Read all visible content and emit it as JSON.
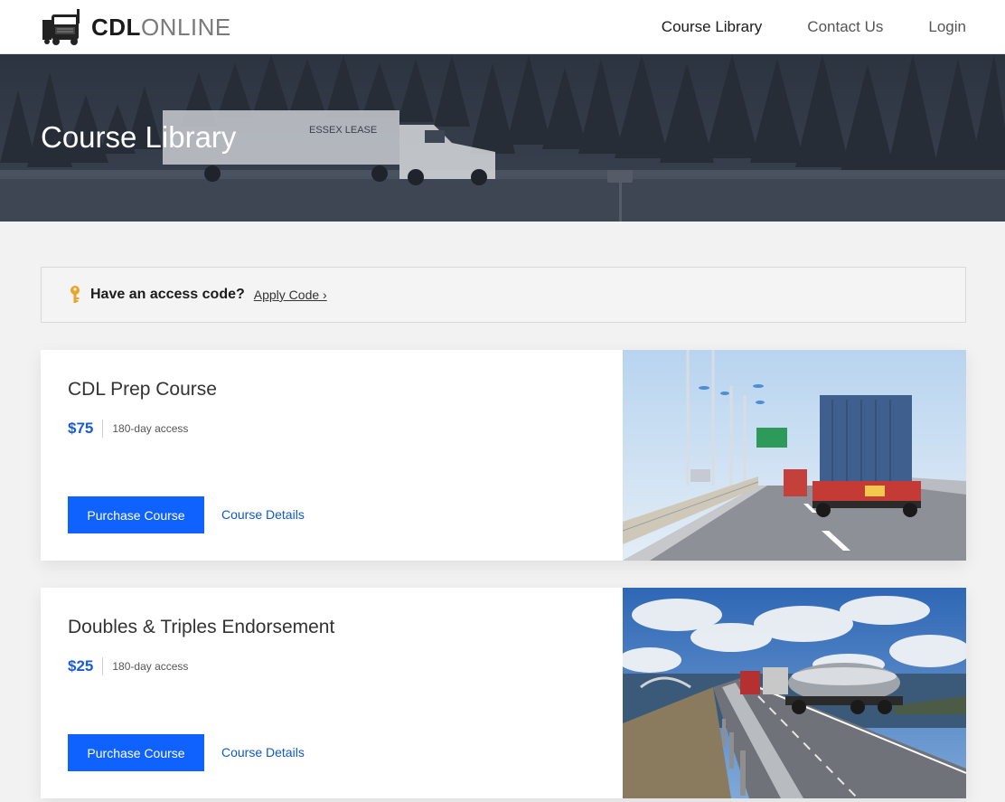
{
  "brand": {
    "name_bold": "CDL",
    "name_light": "ONLINE",
    "logo_icon": "truck-icon"
  },
  "nav": {
    "items": [
      {
        "label": "Course Library",
        "active": true
      },
      {
        "label": "Contact Us",
        "active": false
      },
      {
        "label": "Login",
        "active": false
      }
    ]
  },
  "hero": {
    "title": "Course Library",
    "trailer_text": "ESSEX LEASE"
  },
  "access_code": {
    "icon": "key-icon",
    "question": "Have an access code?",
    "link_label": "Apply Code ›"
  },
  "courses": [
    {
      "title": "CDL Prep Course",
      "price": "$75",
      "access": "180-day access",
      "purchase_label": "Purchase Course",
      "details_label": "Course Details"
    },
    {
      "title": "Doubles & Triples Endorsement",
      "price": "$25",
      "access": "180-day access",
      "purchase_label": "Purchase Course",
      "details_label": "Course Details"
    }
  ],
  "colors": {
    "primary_button": "#0f62fe",
    "price": "#1a5bd6",
    "hero_overlay": "#2c3440"
  }
}
